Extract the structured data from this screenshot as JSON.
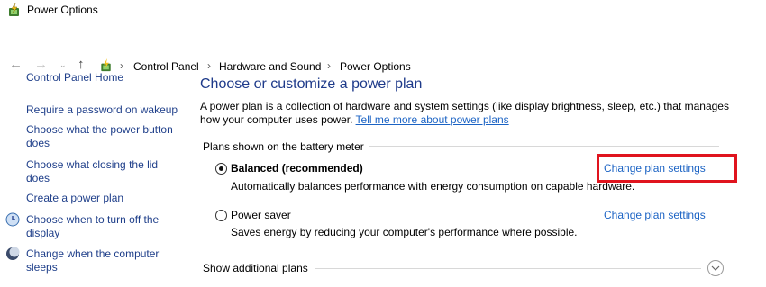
{
  "window": {
    "title": "Power Options"
  },
  "address": {
    "breadcrumbs": [
      "Control Panel",
      "Hardware and Sound",
      "Power Options"
    ]
  },
  "sidebar": {
    "home": "Control Panel Home",
    "items": [
      {
        "label1": "Require a password on wakeup"
      },
      {
        "label1": "Choose what the power button",
        "label2": "does"
      },
      {
        "label1": "Choose what closing the lid",
        "label2": "does"
      },
      {
        "label1": "Create a power plan"
      },
      {
        "label1": "Choose when to turn off the",
        "label2": "display"
      },
      {
        "label1": "Change when the computer",
        "label2": "sleeps"
      }
    ]
  },
  "main": {
    "heading": "Choose or customize a power plan",
    "description_line1": "A power plan is a collection of hardware and system settings (like display brightness, sleep, etc.) that manages",
    "description_line2": "how your computer uses power.",
    "tell_more_link": "Tell me more about power plans",
    "plans_label": "Plans shown on the battery meter",
    "plans": [
      {
        "name": "Balanced (recommended)",
        "description": "Automatically balances performance with energy consumption on capable hardware.",
        "change_link": "Change plan settings",
        "selected": true
      },
      {
        "name": "Power saver",
        "description": "Saves energy by reducing your computer's performance where possible.",
        "change_link": "Change plan settings",
        "selected": false
      }
    ],
    "show_additional": "Show additional plans"
  },
  "colors": {
    "link": "#1b63c4",
    "heading": "#1e3a8a",
    "highlight_box": "#e0141e"
  }
}
